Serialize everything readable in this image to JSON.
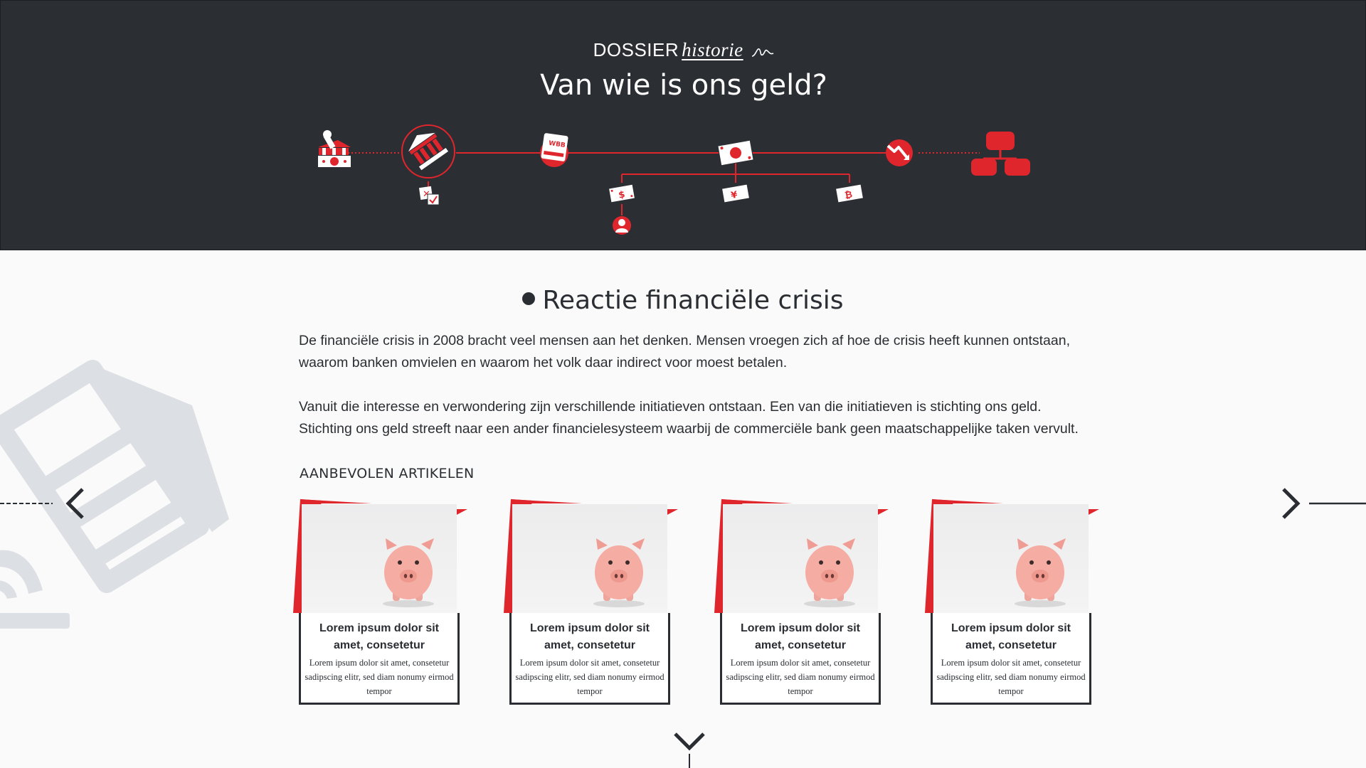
{
  "header": {
    "brand_main": "DOSSIER",
    "brand_script": "historie",
    "title": "Van wie is ons geld?",
    "timeline_icons": [
      "bank-run-icon",
      "bank-icon",
      "document-icon",
      "banknote-icon",
      "downtrend-icon",
      "org-chart-icon",
      "checklist-icon",
      "banknote-small-icon",
      "person-icon"
    ]
  },
  "section": {
    "title": "Reactie financiële crisis",
    "paragraphs": [
      "De financiële crisis in 2008 bracht veel mensen aan het denken. Mensen vroegen zich af hoe de crisis heeft kunnen ontstaan, waarom banken omvielen en waarom het volk daar indirect voor moest betalen.",
      "Vanuit die interesse en verwondering zijn verschillende initiatieven ontstaan. Een van die initiatieven is stichting ons geld. Stichting ons geld streeft naar een ander financielesysteem waarbij de commerciële bank geen maatschappelijke taken vervult."
    ]
  },
  "recommended": {
    "heading": "AANBEVOLEN ARTIKELEN",
    "cards": [
      {
        "title": "Lorem ipsum dolor sit amet, consetetur",
        "text": "Lorem ipsum dolor sit amet, consetetur sadipscing elitr, sed diam nonumy eirmod tempor"
      },
      {
        "title": "Lorem ipsum dolor sit amet, consetetur",
        "text": "Lorem ipsum dolor sit amet, consetetur sadipscing elitr, sed diam nonumy eirmod tempor"
      },
      {
        "title": "Lorem ipsum dolor sit amet, consetetur",
        "text": "Lorem ipsum dolor sit amet, consetetur sadipscing elitr, sed diam nonumy eirmod tempor"
      },
      {
        "title": "Lorem ipsum dolor sit amet, consetetur",
        "text": "Lorem ipsum dolor sit amet, consetetur sadipscing elitr, sed diam nonumy eirmod tempor"
      }
    ]
  },
  "colors": {
    "accent": "#e0262d",
    "header_bg": "#2b2e33",
    "text": "#2a2e33",
    "page_bg": "#fafafa"
  }
}
